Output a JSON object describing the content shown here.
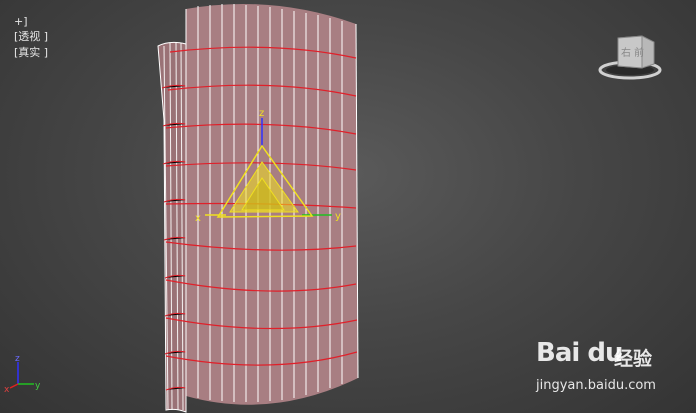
{
  "viewport": {
    "labels": [
      "+]",
      "[透视 ]",
      "[真实 ]"
    ]
  },
  "gizmo": {
    "x_label": "x",
    "y_label": "y",
    "z_label": "z"
  },
  "viewcube": {
    "face_label": "右 前"
  },
  "axis_tripod": {
    "x_label": "x",
    "y_label": "y",
    "z_label": "z"
  },
  "watermark": {
    "brand": "Bai du",
    "cn": "经验",
    "url": "jingyan.baidu.com"
  },
  "colors": {
    "mesh_fill": "#a87e82",
    "mesh_wire": "#ffffff",
    "edge_loops": "#e0202a",
    "gizmo": "#f0e020",
    "gizmo_z": "#3030ff",
    "gizmo_y": "#20c020"
  }
}
